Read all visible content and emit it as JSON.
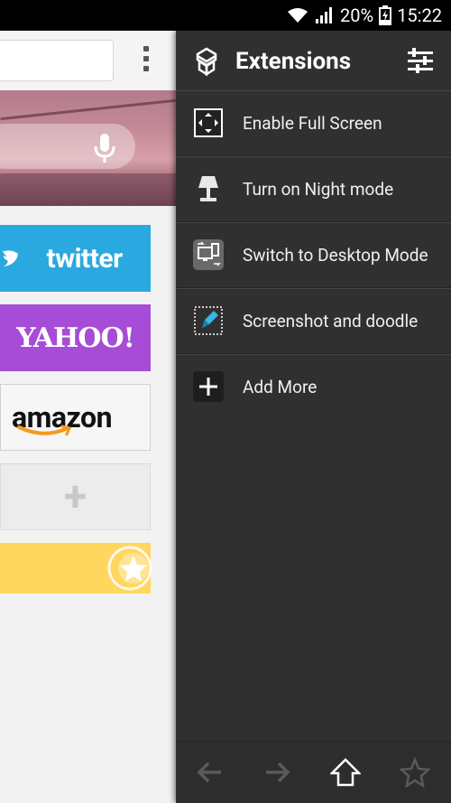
{
  "status_bar": {
    "battery_percent": "20%",
    "time": "15:22"
  },
  "browser": {
    "tiles": [
      {
        "name": "twitter",
        "label": "twitter",
        "color": "#2aa9e0"
      },
      {
        "name": "yahoo",
        "label": "YAHOO!",
        "color": "#a64cd6"
      },
      {
        "name": "amazon",
        "label": "amazon",
        "color": "#f6f6f6"
      },
      {
        "name": "add",
        "label": "+",
        "color": "#ececec"
      },
      {
        "name": "favorites",
        "label": "",
        "color": "#ffd65e"
      }
    ]
  },
  "panel": {
    "title": "Extensions",
    "items": [
      {
        "label": "Enable Full Screen",
        "icon": "fullscreen-icon"
      },
      {
        "label": "Turn on Night mode",
        "icon": "lamp-icon"
      },
      {
        "label": "Switch to Desktop Mode",
        "icon": "desktop-mode-icon"
      },
      {
        "label": "Screenshot and doodle",
        "icon": "doodle-icon"
      },
      {
        "label": "Add More",
        "icon": "add-icon"
      }
    ],
    "bottom_nav": [
      "back-icon",
      "forward-icon",
      "home-icon",
      "star-icon"
    ]
  },
  "colors": {
    "panel_bg": "#303030",
    "accent": "#ffffff"
  }
}
